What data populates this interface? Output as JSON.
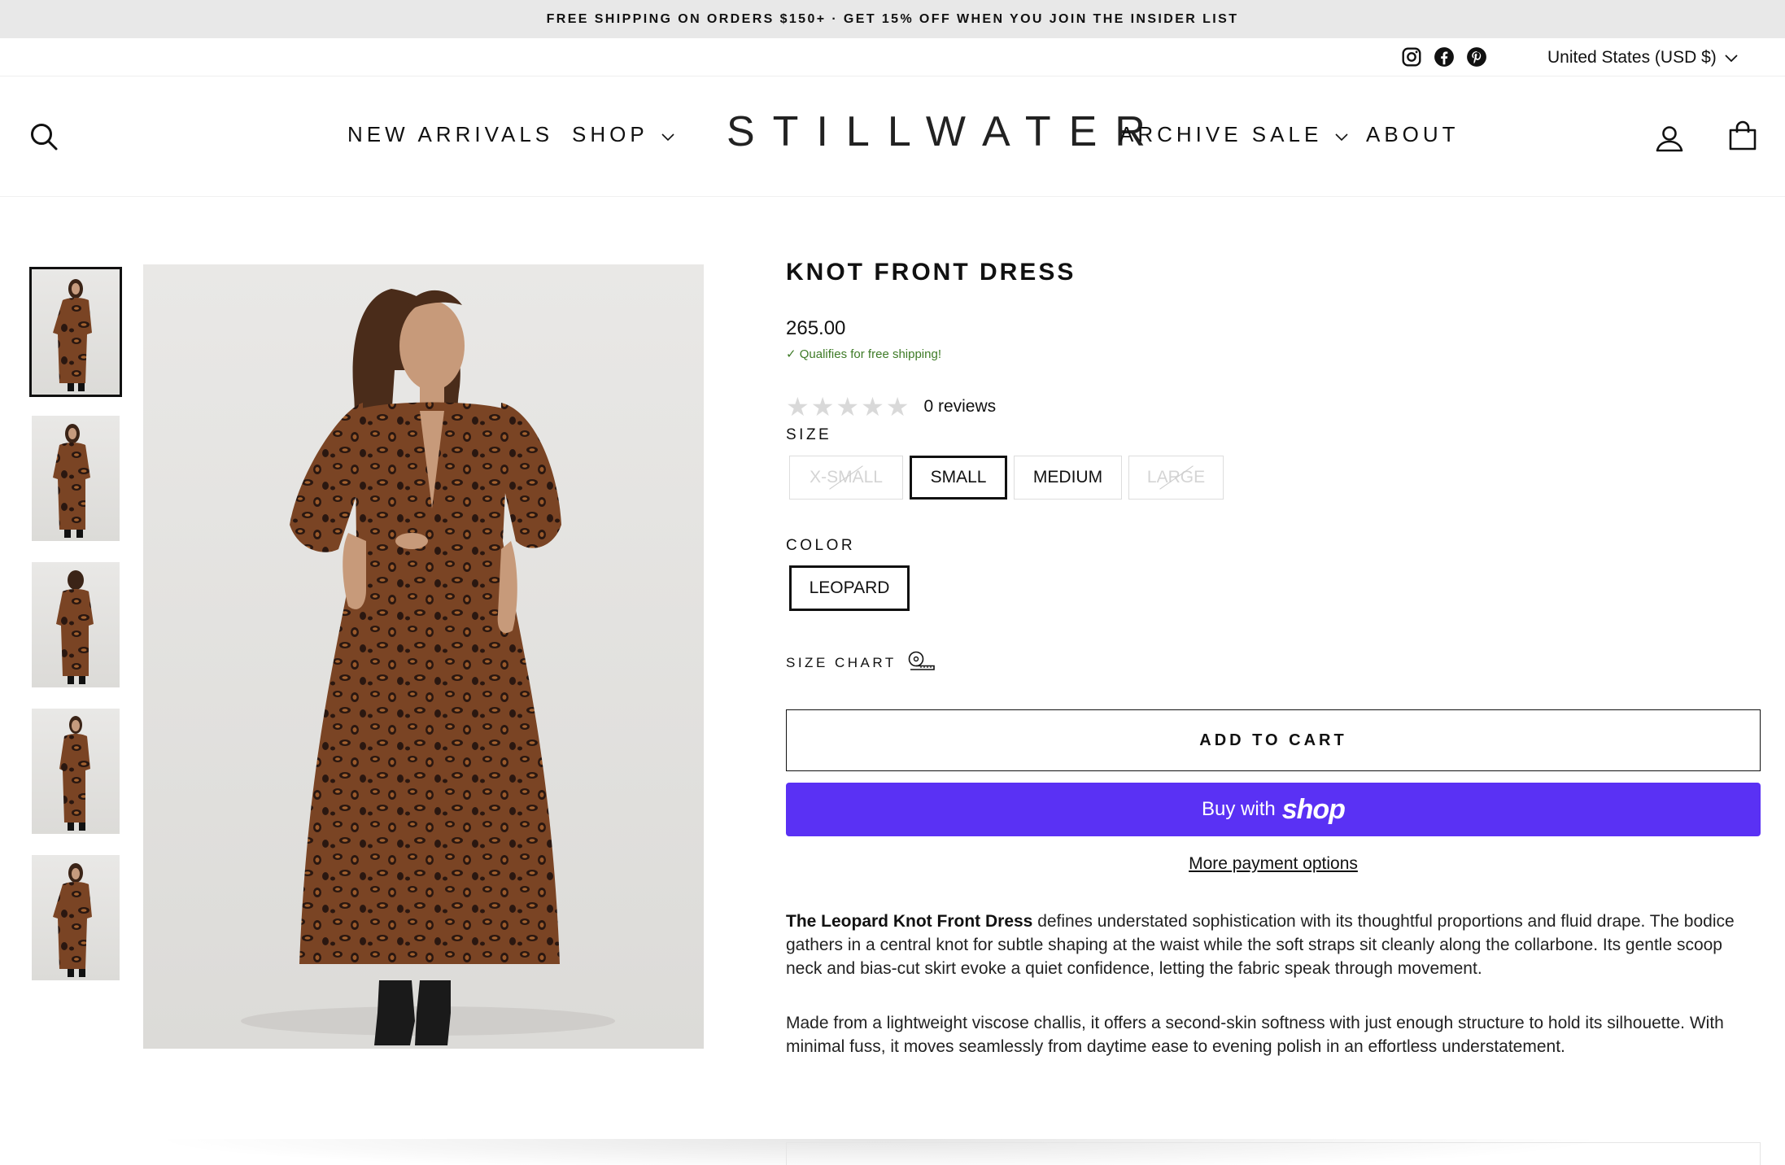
{
  "announcement": "FREE SHIPPING ON ORDERS $150+ · GET 15% OFF WHEN YOU JOIN THE INSIDER LIST",
  "utility": {
    "social_icons": [
      "instagram-icon",
      "facebook-icon",
      "pinterest-icon"
    ],
    "currency": "United States (USD $)"
  },
  "header": {
    "logo": "STILLWATER",
    "nav": {
      "new_arrivals": "NEW ARRIVALS",
      "shop": "SHOP",
      "archive_sale": "ARCHIVE SALE",
      "about": "ABOUT"
    },
    "icons": [
      "search-icon",
      "account-icon",
      "cart-icon"
    ]
  },
  "gallery": {
    "thumbnail_count": 5,
    "active_index": 0
  },
  "product": {
    "title": "KNOT FRONT DRESS",
    "price": "265.00",
    "shipping_note": "✓ Qualifies for free shipping!",
    "rating_stars": 0,
    "reviews": "0 reviews",
    "size_label": "SIZE",
    "sizes": [
      {
        "label": "X-SMALL",
        "state": "disabled"
      },
      {
        "label": "SMALL",
        "state": "selected"
      },
      {
        "label": "MEDIUM",
        "state": "available"
      },
      {
        "label": "LARGE",
        "state": "disabled"
      }
    ],
    "color_label": "COLOR",
    "colors": [
      {
        "label": "LEOPARD",
        "state": "selected"
      }
    ],
    "size_chart": "SIZE CHART",
    "add_to_cart": "ADD TO CART",
    "buy_with": "Buy with",
    "buy_brand": "shop",
    "more_payment": "More payment options",
    "description": {
      "p1_bold": "The Leopard Knot Front Dress",
      "p1_rest": " defines understated sophistication with its thoughtful proportions and fluid drape. The bodice gathers in a central knot for subtle shaping at the waist while the soft straps sit cleanly along the collarbone. Its gentle scoop neck and bias-cut skirt evoke a quiet confidence, letting the fabric speak through movement.",
      "p2": "Made from a lightweight viscose challis, it offers a second-skin softness with just enough structure to hold its silhouette. With minimal fuss, it moves seamlessly from daytime ease to evening polish in an effortless understatement."
    }
  },
  "colors": {
    "accent_shop": "#5a31f4",
    "shipping_green": "#3e7b27",
    "announcement_bg": "#e8e8e8"
  }
}
